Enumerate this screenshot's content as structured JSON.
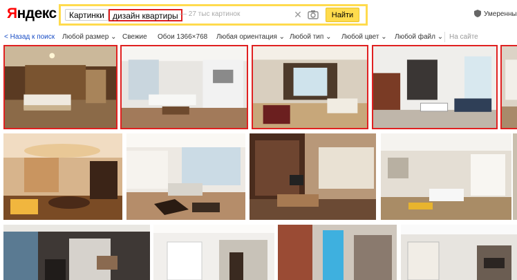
{
  "logo": {
    "first_letter": "Я",
    "rest": "ндекс"
  },
  "search": {
    "service_chip": "Картинки",
    "query": "дизайн квартиры",
    "results_hint": "— 27 тыс картинок",
    "find_label": "Найти"
  },
  "safe_search": {
    "label": "Умеренный"
  },
  "filters": {
    "back": "< Назад к поиск",
    "size": "Любой размер ⌄",
    "fresh": "Свежие",
    "wallpapers": "Обои 1366×768",
    "orientation": "Любая ориентация ⌄",
    "type": "Любой тип ⌄",
    "color": "Любой цвет ⌄",
    "file": "Любой файл ⌄",
    "site_placeholder": "На сайте"
  },
  "colors": {
    "brand_yellow": "#ffdb4d",
    "highlight_red": "#e02020",
    "link_blue": "#1a4ec5"
  },
  "images": [
    {
      "row": 1,
      "alt": "bedroom",
      "highlighted": true
    },
    {
      "row": 1,
      "alt": "living room with kitchen",
      "highlighted": true
    },
    {
      "row": 1,
      "alt": "living room with large window",
      "highlighted": true
    },
    {
      "row": 1,
      "alt": "kitchen living room",
      "highlighted": true
    },
    {
      "row": 1,
      "alt": "partial",
      "highlighted": true
    },
    {
      "row": 2,
      "alt": "orange living room",
      "highlighted": false
    },
    {
      "row": 2,
      "alt": "living room with bay window",
      "highlighted": false
    },
    {
      "row": 2,
      "alt": "living room with bookshelves",
      "highlighted": false
    },
    {
      "row": 2,
      "alt": "bright living room",
      "highlighted": false
    },
    {
      "row": 3,
      "alt": "modern interior",
      "highlighted": false
    },
    {
      "row": 3,
      "alt": "living room white",
      "highlighted": false
    },
    {
      "row": 3,
      "alt": "brick wall interior",
      "highlighted": false
    },
    {
      "row": 3,
      "alt": "loft with big ben picture",
      "highlighted": false
    },
    {
      "row": 3,
      "alt": "living room fireplace",
      "highlighted": false
    }
  ]
}
